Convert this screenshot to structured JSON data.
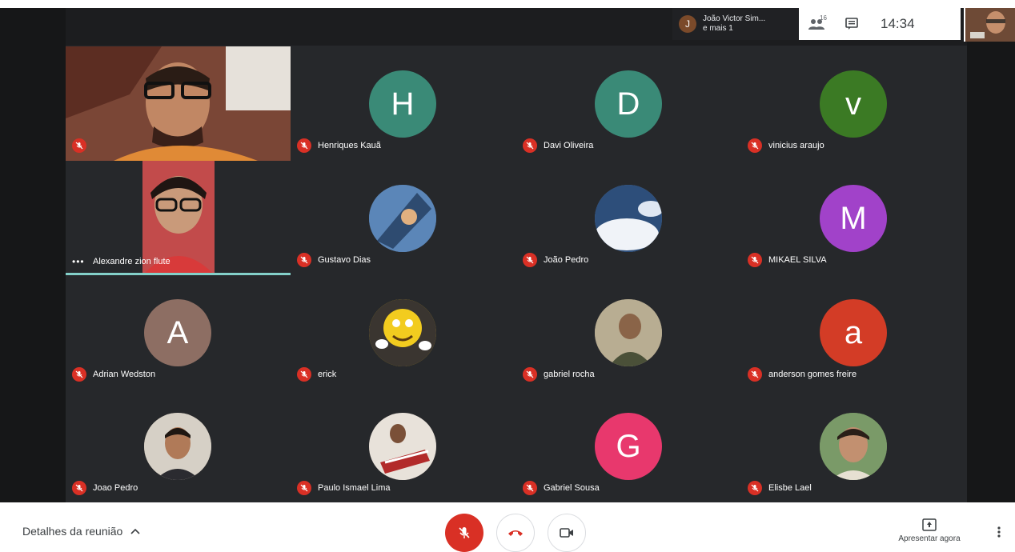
{
  "header": {
    "presenter_initial": "J",
    "presenter_name": "João Victor Sim...",
    "presenter_sub": "e mais 1",
    "people_count": "16",
    "clock": "14:34"
  },
  "participants": [
    {
      "name": "",
      "type": "video",
      "scene": "man-glasses"
    },
    {
      "name": "Henriques Kauã",
      "initial": "H",
      "color": "#3a8a77"
    },
    {
      "name": "Davi Oliveira",
      "initial": "D",
      "color": "#3a8a77"
    },
    {
      "name": "vinicius araujo",
      "initial": "v",
      "color": "#3b7a24"
    },
    {
      "name": "Alexandre zion flute",
      "type": "video",
      "scene": "person-glasses"
    },
    {
      "name": "Gustavo Dias",
      "type": "photo",
      "color": "#4a6f9a"
    },
    {
      "name": "João Pedro",
      "type": "photo",
      "color": "#5d7fa8"
    },
    {
      "name": "MIKAEL SILVA",
      "initial": "M",
      "color": "#a142c9"
    },
    {
      "name": "Adrian Wedston",
      "initial": "A",
      "color": "#8d6e63"
    },
    {
      "name": "erick",
      "type": "photo",
      "color": "#d8b21a"
    },
    {
      "name": "gabriel rocha",
      "type": "photo",
      "color": "#9a8c72"
    },
    {
      "name": "anderson gomes freire",
      "initial": "a",
      "color": "#d33c26"
    },
    {
      "name": "Joao Pedro",
      "type": "photo",
      "color": "#9a8570"
    },
    {
      "name": "Paulo Ismael Lima",
      "type": "photo",
      "color": "#5a4a44"
    },
    {
      "name": "Gabriel Sousa",
      "initial": "G",
      "color": "#e8386d"
    },
    {
      "name": "Elisbe Lael",
      "type": "photo",
      "color": "#6b8a5a"
    }
  ],
  "footer": {
    "details_label": "Detalhes da reunião",
    "present_label": "Apresentar agora"
  },
  "colors": {
    "mute_red": "#d93025",
    "tile_bg": "#26282b",
    "active_speaker": "#83d0c9"
  }
}
